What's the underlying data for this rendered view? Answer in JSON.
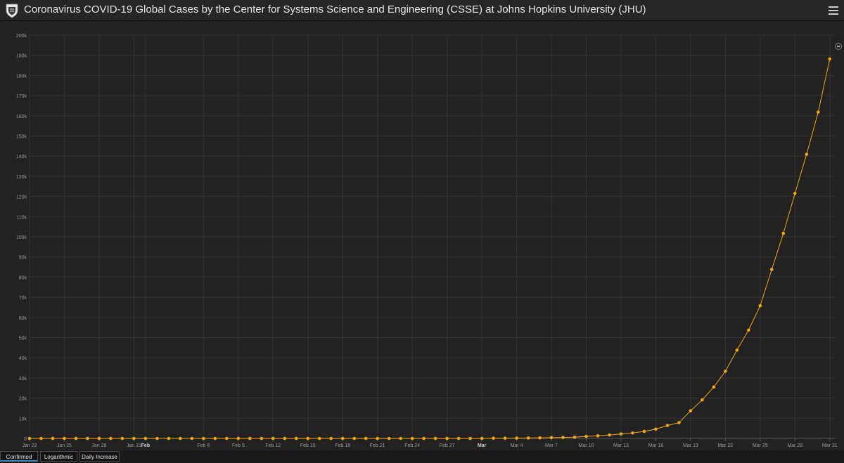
{
  "header": {
    "title": "Coronavirus COVID-19 Global Cases by the Center for Systems Science and Engineering (CSSE) at Johns Hopkins University (JHU)",
    "logo_icon": "university-shield-icon",
    "menu_icon": "hamburger-menu-icon"
  },
  "colors": {
    "series": "#f2a60f",
    "background": "#222222",
    "grid": "#333333",
    "axis_text": "#9a9a9a"
  },
  "tabs": [
    {
      "label": "Confirmed",
      "active": true
    },
    {
      "label": "Logarithmic",
      "active": false
    },
    {
      "label": "Daily Increase",
      "active": false
    }
  ],
  "chart_data": {
    "type": "line",
    "title": "",
    "xlabel": "",
    "ylabel": "",
    "ylim": [
      0,
      200000
    ],
    "grid": true,
    "y_ticks": [
      {
        "value": 0,
        "label": "0"
      },
      {
        "value": 10000,
        "label": "10k"
      },
      {
        "value": 20000,
        "label": "20k"
      },
      {
        "value": 30000,
        "label": "30k"
      },
      {
        "value": 40000,
        "label": "40k"
      },
      {
        "value": 50000,
        "label": "50k"
      },
      {
        "value": 60000,
        "label": "60k"
      },
      {
        "value": 70000,
        "label": "70k"
      },
      {
        "value": 80000,
        "label": "80k"
      },
      {
        "value": 90000,
        "label": "90k"
      },
      {
        "value": 100000,
        "label": "100k"
      },
      {
        "value": 110000,
        "label": "110k"
      },
      {
        "value": 120000,
        "label": "120k"
      },
      {
        "value": 130000,
        "label": "130k"
      },
      {
        "value": 140000,
        "label": "140k"
      },
      {
        "value": 150000,
        "label": "150k"
      },
      {
        "value": 160000,
        "label": "160k"
      },
      {
        "value": 170000,
        "label": "170k"
      },
      {
        "value": 180000,
        "label": "180k"
      },
      {
        "value": 190000,
        "label": "190k"
      },
      {
        "value": 200000,
        "label": "200k"
      }
    ],
    "x_ticks": [
      {
        "date": "2020-01-22",
        "label": "Jan 22",
        "bold": false
      },
      {
        "date": "2020-01-25",
        "label": "Jan 25",
        "bold": false
      },
      {
        "date": "2020-01-28",
        "label": "Jan 28",
        "bold": false
      },
      {
        "date": "2020-01-31",
        "label": "Jan 31",
        "bold": false
      },
      {
        "date": "2020-02-01",
        "label": "Feb",
        "bold": true
      },
      {
        "date": "2020-02-06",
        "label": "Feb 6",
        "bold": false
      },
      {
        "date": "2020-02-09",
        "label": "Feb 9",
        "bold": false
      },
      {
        "date": "2020-02-12",
        "label": "Feb 12",
        "bold": false
      },
      {
        "date": "2020-02-15",
        "label": "Feb 15",
        "bold": false
      },
      {
        "date": "2020-02-18",
        "label": "Feb 18",
        "bold": false
      },
      {
        "date": "2020-02-21",
        "label": "Feb 21",
        "bold": false
      },
      {
        "date": "2020-02-24",
        "label": "Feb 24",
        "bold": false
      },
      {
        "date": "2020-02-27",
        "label": "Feb 27",
        "bold": false
      },
      {
        "date": "2020-03-01",
        "label": "Mar",
        "bold": true
      },
      {
        "date": "2020-03-04",
        "label": "Mar 4",
        "bold": false
      },
      {
        "date": "2020-03-07",
        "label": "Mar 7",
        "bold": false
      },
      {
        "date": "2020-03-10",
        "label": "Mar 10",
        "bold": false
      },
      {
        "date": "2020-03-13",
        "label": "Mar 13",
        "bold": false
      },
      {
        "date": "2020-03-16",
        "label": "Mar 16",
        "bold": false
      },
      {
        "date": "2020-03-19",
        "label": "Mar 19",
        "bold": false
      },
      {
        "date": "2020-03-22",
        "label": "Mar 22",
        "bold": false
      },
      {
        "date": "2020-03-25",
        "label": "Mar 25",
        "bold": false
      },
      {
        "date": "2020-03-28",
        "label": "Mar 28",
        "bold": false
      },
      {
        "date": "2020-03-31",
        "label": "Mar 31",
        "bold": false
      }
    ],
    "series": [
      {
        "name": "Confirmed",
        "color": "#f2a60f",
        "points": [
          {
            "x": "2020-01-22",
            "y": 0
          },
          {
            "x": "2020-01-23",
            "y": 0
          },
          {
            "x": "2020-01-24",
            "y": 0
          },
          {
            "x": "2020-01-25",
            "y": 0
          },
          {
            "x": "2020-01-26",
            "y": 0
          },
          {
            "x": "2020-01-27",
            "y": 0
          },
          {
            "x": "2020-01-28",
            "y": 0
          },
          {
            "x": "2020-01-29",
            "y": 0
          },
          {
            "x": "2020-01-30",
            "y": 0
          },
          {
            "x": "2020-01-31",
            "y": 0
          },
          {
            "x": "2020-02-01",
            "y": 0
          },
          {
            "x": "2020-02-02",
            "y": 0
          },
          {
            "x": "2020-02-03",
            "y": 0
          },
          {
            "x": "2020-02-04",
            "y": 0
          },
          {
            "x": "2020-02-05",
            "y": 0
          },
          {
            "x": "2020-02-06",
            "y": 0
          },
          {
            "x": "2020-02-07",
            "y": 0
          },
          {
            "x": "2020-02-08",
            "y": 0
          },
          {
            "x": "2020-02-09",
            "y": 0
          },
          {
            "x": "2020-02-10",
            "y": 0
          },
          {
            "x": "2020-02-11",
            "y": 0
          },
          {
            "x": "2020-02-12",
            "y": 0
          },
          {
            "x": "2020-02-13",
            "y": 0
          },
          {
            "x": "2020-02-14",
            "y": 0
          },
          {
            "x": "2020-02-15",
            "y": 0
          },
          {
            "x": "2020-02-16",
            "y": 0
          },
          {
            "x": "2020-02-17",
            "y": 0
          },
          {
            "x": "2020-02-18",
            "y": 0
          },
          {
            "x": "2020-02-19",
            "y": 0
          },
          {
            "x": "2020-02-20",
            "y": 0
          },
          {
            "x": "2020-02-21",
            "y": 0
          },
          {
            "x": "2020-02-22",
            "y": 0
          },
          {
            "x": "2020-02-23",
            "y": 0
          },
          {
            "x": "2020-02-24",
            "y": 0
          },
          {
            "x": "2020-02-25",
            "y": 0
          },
          {
            "x": "2020-02-26",
            "y": 0
          },
          {
            "x": "2020-02-27",
            "y": 0
          },
          {
            "x": "2020-02-28",
            "y": 0
          },
          {
            "x": "2020-02-29",
            "y": 0
          },
          {
            "x": "2020-03-01",
            "y": 0
          },
          {
            "x": "2020-03-02",
            "y": 100
          },
          {
            "x": "2020-03-03",
            "y": 100
          },
          {
            "x": "2020-03-04",
            "y": 150
          },
          {
            "x": "2020-03-05",
            "y": 200
          },
          {
            "x": "2020-03-06",
            "y": 300
          },
          {
            "x": "2020-03-07",
            "y": 400
          },
          {
            "x": "2020-03-08",
            "y": 500
          },
          {
            "x": "2020-03-09",
            "y": 600
          },
          {
            "x": "2020-03-10",
            "y": 1000
          },
          {
            "x": "2020-03-11",
            "y": 1300
          },
          {
            "x": "2020-03-12",
            "y": 1700
          },
          {
            "x": "2020-03-13",
            "y": 2200
          },
          {
            "x": "2020-03-14",
            "y": 2700
          },
          {
            "x": "2020-03-15",
            "y": 3500
          },
          {
            "x": "2020-03-16",
            "y": 4600
          },
          {
            "x": "2020-03-17",
            "y": 6400
          },
          {
            "x": "2020-03-18",
            "y": 7800
          },
          {
            "x": "2020-03-19",
            "y": 13700
          },
          {
            "x": "2020-03-20",
            "y": 19100
          },
          {
            "x": "2020-03-21",
            "y": 25500
          },
          {
            "x": "2020-03-22",
            "y": 33300
          },
          {
            "x": "2020-03-23",
            "y": 43800
          },
          {
            "x": "2020-03-24",
            "y": 53700
          },
          {
            "x": "2020-03-25",
            "y": 65800
          },
          {
            "x": "2020-03-26",
            "y": 83800
          },
          {
            "x": "2020-03-27",
            "y": 101700
          },
          {
            "x": "2020-03-28",
            "y": 121500
          },
          {
            "x": "2020-03-29",
            "y": 140900
          },
          {
            "x": "2020-03-30",
            "y": 161800
          },
          {
            "x": "2020-03-31",
            "y": 188200
          }
        ]
      }
    ]
  }
}
